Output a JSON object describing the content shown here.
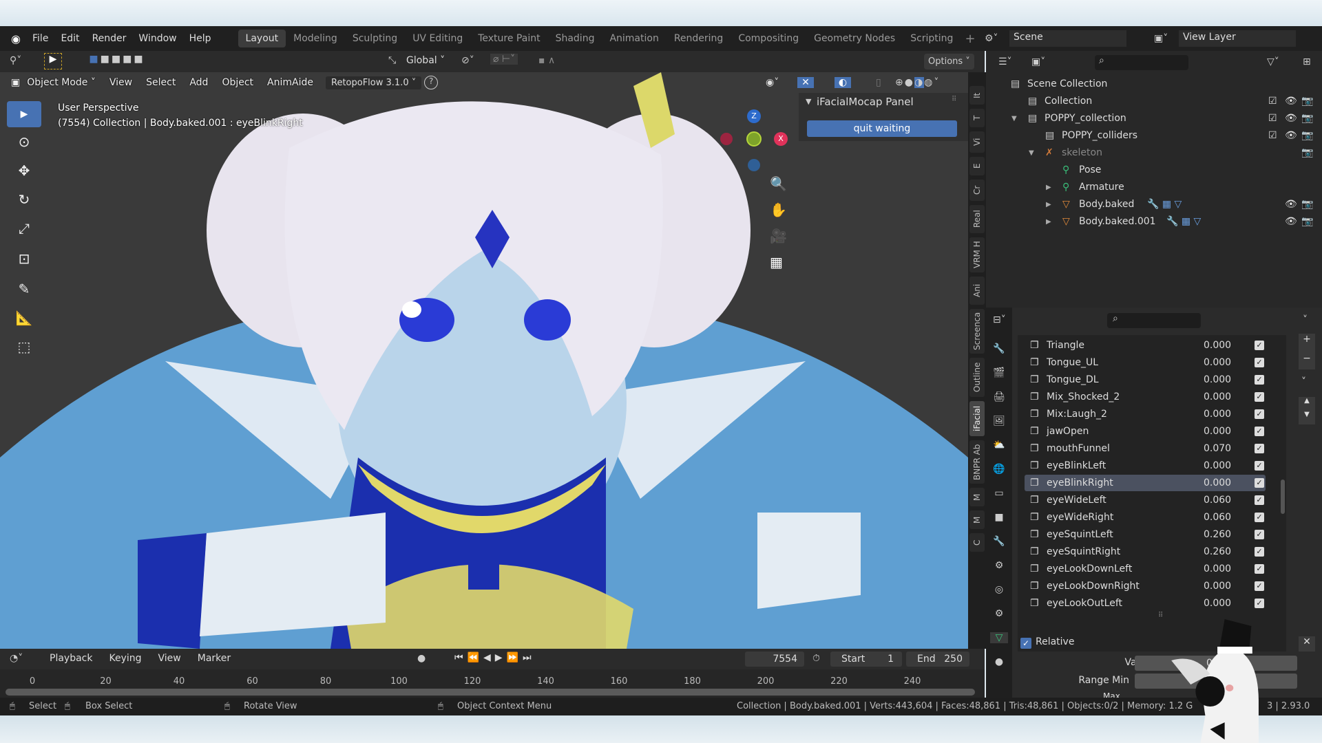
{
  "menubar": {
    "items": [
      "File",
      "Edit",
      "Render",
      "Window",
      "Help"
    ],
    "workspaces": [
      "Layout",
      "Modeling",
      "Sculpting",
      "UV Editing",
      "Texture Paint",
      "Shading",
      "Animation",
      "Rendering",
      "Compositing",
      "Geometry Nodes",
      "Scripting"
    ],
    "active_workspace": "Layout",
    "scene": "Scene",
    "view_layer": "View Layer"
  },
  "header": {
    "orientation": "Global",
    "options": "Options"
  },
  "viewport": {
    "mode": "Object Mode",
    "menus": [
      "View",
      "Select",
      "Add",
      "Object",
      "AnimAide"
    ],
    "addon": "RetopoFlow 3.1.0",
    "perspective": "User Perspective",
    "info": "(7554) Collection | Body.baked.001 : eyeBlinkRight",
    "gizmo": {
      "z": "Z",
      "x": "X"
    }
  },
  "npanel": {
    "title": "iFacialMocap Panel",
    "button": "quit waiting",
    "tabs": [
      "It",
      "T",
      "Vi",
      "E",
      "Cr",
      "Real",
      "VRM H",
      "Ani",
      "Screenca",
      "Outline",
      "iFacial",
      "BNPR Ab",
      "M",
      "M",
      "C"
    ],
    "active_tab": "iFacial"
  },
  "outliner": {
    "items": [
      {
        "label": "Scene Collection",
        "depth": 0
      },
      {
        "label": "Collection",
        "depth": 1
      },
      {
        "label": "POPPY_collection",
        "depth": 1
      },
      {
        "label": "POPPY_colliders",
        "depth": 2
      },
      {
        "label": "skeleton",
        "depth": 2
      },
      {
        "label": "Pose",
        "depth": 3
      },
      {
        "label": "Armature",
        "depth": 3
      },
      {
        "label": "Body.baked",
        "depth": 3
      },
      {
        "label": "Body.baked.001",
        "depth": 3
      }
    ]
  },
  "shape_keys": {
    "items": [
      {
        "name": "Triangle",
        "value": "0.000"
      },
      {
        "name": "Tongue_UL",
        "value": "0.000"
      },
      {
        "name": "Tongue_DL",
        "value": "0.000"
      },
      {
        "name": "Mix_Shocked_2",
        "value": "0.000"
      },
      {
        "name": "Mix:Laugh_2",
        "value": "0.000"
      },
      {
        "name": "jawOpen",
        "value": "0.000"
      },
      {
        "name": "mouthFunnel",
        "value": "0.070"
      },
      {
        "name": "eyeBlinkLeft",
        "value": "0.000"
      },
      {
        "name": "eyeBlinkRight",
        "value": "0.000",
        "selected": true
      },
      {
        "name": "eyeWideLeft",
        "value": "0.060"
      },
      {
        "name": "eyeWideRight",
        "value": "0.060"
      },
      {
        "name": "eyeSquintLeft",
        "value": "0.260"
      },
      {
        "name": "eyeSquintRight",
        "value": "0.260"
      },
      {
        "name": "eyeLookDownLeft",
        "value": "0.000"
      },
      {
        "name": "eyeLookDownRight",
        "value": "0.000"
      },
      {
        "name": "eyeLookOutLeft",
        "value": "0.000"
      }
    ],
    "relative": "Relative",
    "value_label": "Value",
    "value": "0.0",
    "range_min_label": "Range Min",
    "max_label": "Max"
  },
  "timeline": {
    "menus": [
      "Playback",
      "Keying",
      "View",
      "Marker"
    ],
    "current_frame": "7554",
    "start_label": "Start",
    "start": "1",
    "end_label": "End",
    "end": "250",
    "ticks": [
      "0",
      "20",
      "40",
      "60",
      "80",
      "100",
      "120",
      "140",
      "160",
      "180",
      "200",
      "220",
      "240"
    ]
  },
  "status": {
    "select": "Select",
    "box_select": "Box Select",
    "rotate": "Rotate View",
    "context": "Object Context Menu",
    "stats": "Collection | Body.baked.001 | Verts:443,604 | Faces:48,861 | Tris:48,861 | Objects:0/2 | Memory: 1.2 G",
    "version": "3 | 2.93.0"
  },
  "colors": {
    "accent": "#4772b3",
    "bg": "#282828"
  }
}
